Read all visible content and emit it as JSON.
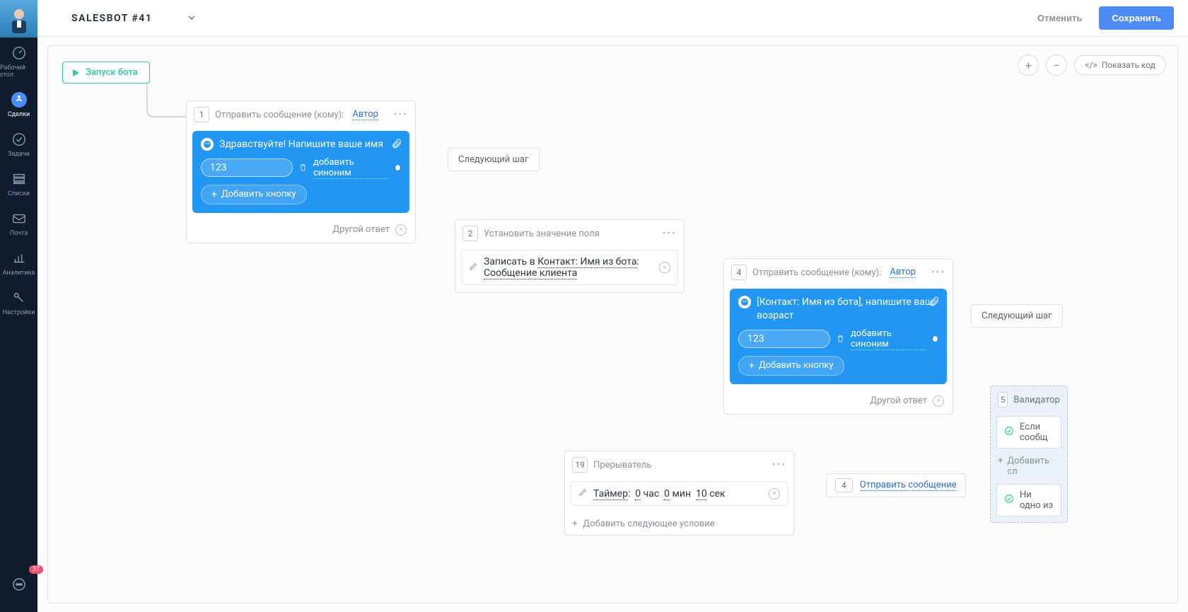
{
  "sidebar": {
    "items": [
      {
        "label": "Рабочий стол"
      },
      {
        "label": "Сделки"
      },
      {
        "label": "Задачи"
      },
      {
        "label": "Списки"
      },
      {
        "label": "Почта"
      },
      {
        "label": "Аналитика"
      },
      {
        "label": "Настройки"
      }
    ],
    "chat_badge": "37"
  },
  "topbar": {
    "title": "SALESBOT #41",
    "cancel": "Отменить",
    "save": "Сохранить"
  },
  "toolbar": {
    "show_code": "Показать код"
  },
  "start_node": {
    "label": "Запуск бота"
  },
  "step1": {
    "num": "1",
    "prefix": "Отправить сообщение (кому):",
    "author": "Автор",
    "message": "Здравствуйте! Напишите ваше имя",
    "input_value": "123",
    "synonym": "добавить синоним",
    "add_button": "Добавить кнопку",
    "other_answer": "Другой ответ"
  },
  "next1": {
    "label": "Следующий шаг"
  },
  "step2": {
    "num": "2",
    "title": "Установить значение поля",
    "prefix": "Записать в ",
    "field1": "Контакт: Имя из бота",
    "sep": ": ",
    "field2": "Сообщение клиента"
  },
  "step4": {
    "num": "4",
    "prefix": "Отправить сообщение (кому):",
    "author": "Автор",
    "message": "[Контакт: Имя из бота], напишите ваш возраст",
    "input_value": "123",
    "synonym": "добавить синоним",
    "add_button": "Добавить кнопку",
    "other_answer": "Другой ответ"
  },
  "next4": {
    "label": "Следующий шаг"
  },
  "step19": {
    "num": "19",
    "title": "Прерыватель",
    "timer_label": "Таймер",
    "h_val": "0",
    "h_unit": "час",
    "m_val": "0",
    "m_unit": "мин",
    "s_val": "10",
    "s_unit": "сек",
    "add_cond": "Добавить следующее условие"
  },
  "ref4": {
    "num": "4",
    "label": "Отправить сообщение"
  },
  "validator": {
    "num": "5",
    "title": "Валидатор",
    "row1": "Если сообщ",
    "add": "Добавить сл",
    "row2": "Ни одно из"
  }
}
